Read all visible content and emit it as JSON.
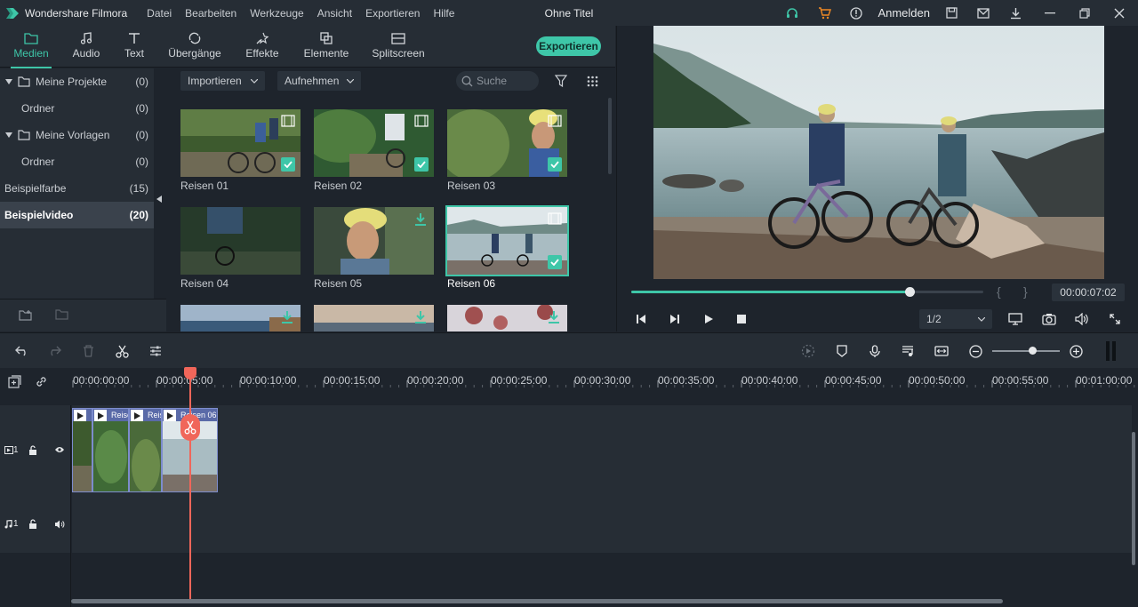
{
  "titlebar": {
    "app_name": "Wondershare Filmora",
    "menu": [
      "Datei",
      "Bearbeiten",
      "Werkzeuge",
      "Ansicht",
      "Exportieren",
      "Hilfe"
    ],
    "doc_title": "Ohne Titel",
    "login": "Anmelden"
  },
  "media_tabs": [
    {
      "label": "Medien",
      "icon": "folder-icon",
      "active": true
    },
    {
      "label": "Audio",
      "icon": "music-note-icon",
      "active": false
    },
    {
      "label": "Text",
      "icon": "text-icon",
      "active": false
    },
    {
      "label": "Übergänge",
      "icon": "transition-icon",
      "active": false
    },
    {
      "label": "Effekte",
      "icon": "effects-icon",
      "active": false
    },
    {
      "label": "Elemente",
      "icon": "elements-icon",
      "active": false
    },
    {
      "label": "Splitscreen",
      "icon": "splitscreen-icon",
      "active": false
    }
  ],
  "export_label": "Exportieren",
  "library": {
    "rows": [
      {
        "label": "Meine Projekte",
        "count": "(0)"
      },
      {
        "label": "Ordner",
        "count": "(0)"
      },
      {
        "label": "Meine Vorlagen",
        "count": "(0)"
      },
      {
        "label": "Ordner",
        "count": "(0)"
      },
      {
        "label": "Beispielfarbe",
        "count": "(15)"
      },
      {
        "label": "Beispielvideo",
        "count": "(20)"
      }
    ]
  },
  "media_toolbar": {
    "import_label": "Importieren",
    "record_label": "Aufnehmen",
    "search_placeholder": "Suche"
  },
  "media_items": [
    {
      "label": "Reisen 01"
    },
    {
      "label": "Reisen 02"
    },
    {
      "label": "Reisen 03"
    },
    {
      "label": "Reisen 04"
    },
    {
      "label": "Reisen 05"
    },
    {
      "label": "Reisen 06"
    }
  ],
  "preview": {
    "progress": 0.79,
    "timecode": "00:00:07:02",
    "quality": "1/2"
  },
  "ruler_labels": [
    "00:00:00:00",
    "00:00:05:00",
    "00:00:10:00",
    "00:00:15:00",
    "00:00:20:00",
    "00:00:25:00",
    "00:00:30:00",
    "00:00:35:00",
    "00:00:40:00",
    "00:00:45:00",
    "00:00:50:00",
    "00:00:55:00",
    "00:01:00:00"
  ],
  "tracks": {
    "video_label": "1",
    "audio_label": "1"
  },
  "clips": [
    {
      "label": ""
    },
    {
      "label": "Reise"
    },
    {
      "label": "Reise"
    },
    {
      "label": "Reisen 06"
    }
  ],
  "colors": {
    "accent": "#3ec6a8",
    "playhead": "#f0665a",
    "clip": "#5a6aa8"
  }
}
